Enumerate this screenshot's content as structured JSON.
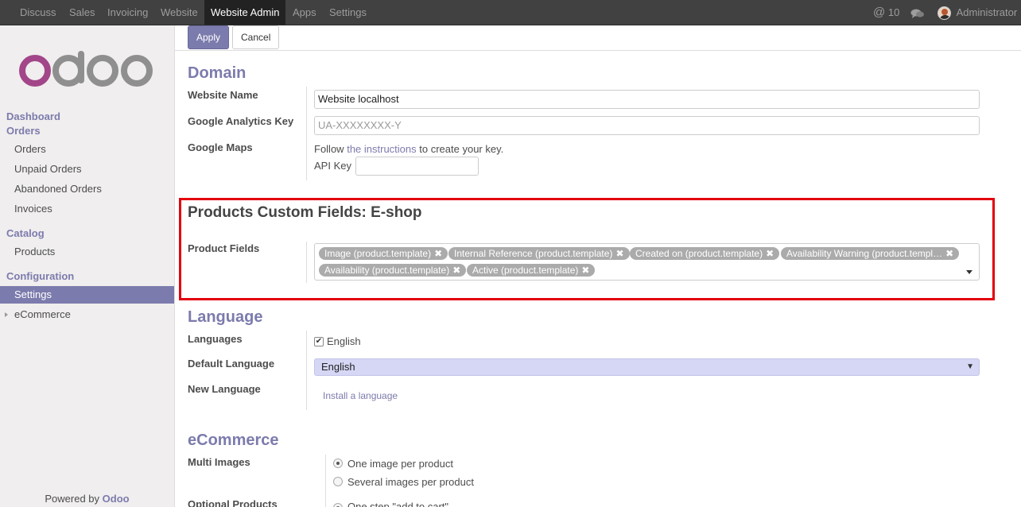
{
  "topnav": {
    "items": [
      "Discuss",
      "Sales",
      "Invoicing",
      "Website",
      "Website Admin",
      "Apps",
      "Settings"
    ],
    "active": "Website Admin",
    "mentions_count": "10",
    "user_name": "Administrator"
  },
  "sidebar": {
    "brand": "odoo",
    "sections": [
      {
        "title": "Dashboard"
      },
      {
        "title": "Orders",
        "items": [
          "Orders",
          "Unpaid Orders",
          "Abandoned Orders",
          "Invoices"
        ]
      },
      {
        "title": "Catalog",
        "items": [
          "Products"
        ]
      },
      {
        "title": "Configuration",
        "items": [
          "Settings"
        ]
      }
    ],
    "active_item": "Settings",
    "tree_item": "eCommerce",
    "powered_by_prefix": "Powered by",
    "powered_by_brand": "Odoo"
  },
  "toolbar": {
    "apply_label": "Apply",
    "cancel_label": "Cancel"
  },
  "form": {
    "domain": {
      "title": "Domain",
      "website_name_label": "Website Name",
      "website_name_value": "Website localhost",
      "ga_label": "Google Analytics Key",
      "ga_placeholder": "UA-XXXXXXXX-Y",
      "maps_label": "Google Maps",
      "maps_text_prefix": "Follow",
      "maps_link": "the instructions",
      "maps_text_suffix": "to create your key.",
      "api_key_label": "API Key",
      "api_key_value": ""
    },
    "custom_fields": {
      "title": "Products Custom Fields: E-shop",
      "product_fields_label": "Product Fields",
      "tags": [
        "Image (product.template)",
        "Internal Reference (product.template)",
        "Created on (product.template)",
        "Availability Warning (product.templ…",
        "Availability (product.template)",
        "Active (product.template)"
      ]
    },
    "language": {
      "title": "Language",
      "languages_label": "Languages",
      "language_option": "English",
      "language_checked": true,
      "default_label": "Default Language",
      "default_value": "English",
      "new_label": "New Language",
      "install_link": "Install a language"
    },
    "ecommerce": {
      "title": "eCommerce",
      "multi_images_label": "Multi Images",
      "multi_images_options": [
        "One image per product",
        "Several images per product"
      ],
      "multi_images_selected": "One image per product",
      "optional_products_label": "Optional Products",
      "optional_products_first_option": "One step \"add to cart\""
    }
  },
  "colors": {
    "accent": "#7c7bad",
    "highlight_border": "#e3000f",
    "navbar": "#414141"
  }
}
